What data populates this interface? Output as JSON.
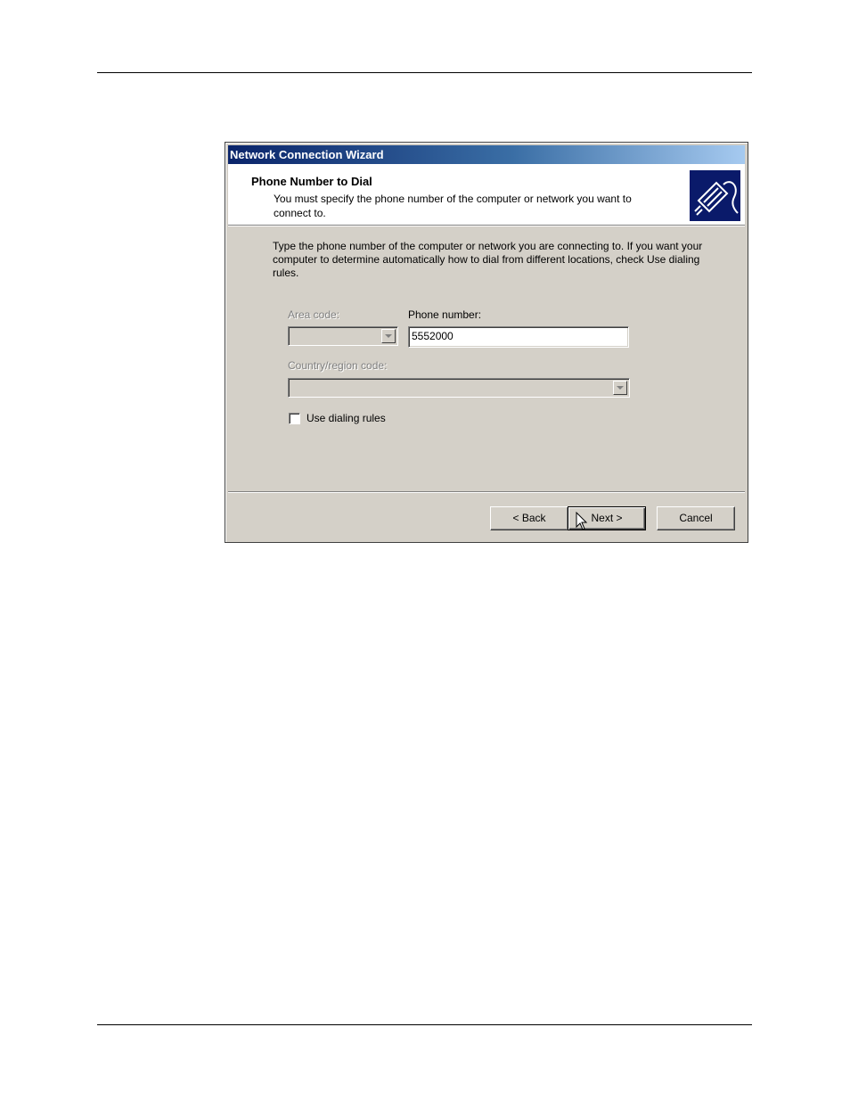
{
  "dialog": {
    "title": "Network Connection Wizard",
    "header": {
      "title": "Phone Number to Dial",
      "subtitle": "You must specify the phone number of the computer or network you want to connect to.",
      "icon": "network-cable-icon"
    },
    "intro": "Type the phone number of the computer or network you are connecting to. If you want your computer to determine automatically how to dial from different locations, check Use dialing rules.",
    "area_code": {
      "label": "Area code:",
      "value": "",
      "enabled": false
    },
    "phone_number": {
      "label": "Phone number:",
      "value": "5552000"
    },
    "country_code": {
      "label": "Country/region code:",
      "value": "",
      "enabled": false
    },
    "dialing_rules": {
      "label": "Use dialing rules",
      "checked": false
    },
    "buttons": {
      "back": "< Back",
      "next": "Next >",
      "cancel": "Cancel"
    }
  },
  "colors": {
    "title_gradient_start": "#0a246a",
    "title_gradient_end": "#a6caf0",
    "dialog_face": "#d4d0c8"
  }
}
